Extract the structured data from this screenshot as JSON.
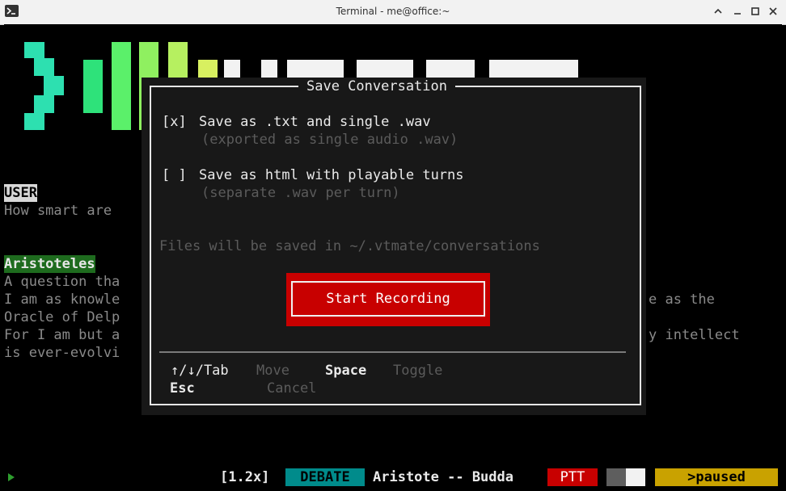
{
  "window": {
    "title": "Terminal - me@office:~"
  },
  "transcript": {
    "user_label": "USER",
    "user_text": "How smart are",
    "assistant_label": "Aristoteles",
    "assistant_lines": [
      "A question tha",
      "I am as knowle",
      "Oracle of Delp",
      "For I am but a",
      "is ever-evolvi"
    ],
    "assistant_right_lines": [
      "e as the",
      "y intellect"
    ]
  },
  "dialog": {
    "title": "Save Conversation",
    "options": [
      {
        "checkbox": "[x]",
        "label": "Save as .txt and single .wav",
        "sub": "(exported as single audio .wav)",
        "checked": true
      },
      {
        "checkbox": "[ ]",
        "label": "Save as html with playable turns",
        "sub": "(separate .wav per turn)",
        "checked": false
      }
    ],
    "info": "Files will be saved in ~/.vtmate/conversations",
    "record_button": "Start Recording",
    "hints": [
      {
        "key": "↑/↓/Tab",
        "desc": "Move"
      },
      {
        "key": "Space",
        "desc": "Toggle"
      },
      {
        "key": "Esc",
        "desc": "Cancel"
      }
    ]
  },
  "statusbar": {
    "prompt_icon": "play-icon",
    "speed": "[1.2x]",
    "mode": "DEBATE",
    "participants": "Aristote -- Budda",
    "ptt": "PTT",
    "state": ">paused"
  },
  "colors": {
    "terminal_bg": "#000000",
    "dialog_bg": "#181818",
    "record_red": "#c80000",
    "mode_teal": "#008b8b",
    "ptt_red": "#c80000",
    "paused_yellow": "#c9a200",
    "assistant_label_green": "#1e6b1e"
  }
}
